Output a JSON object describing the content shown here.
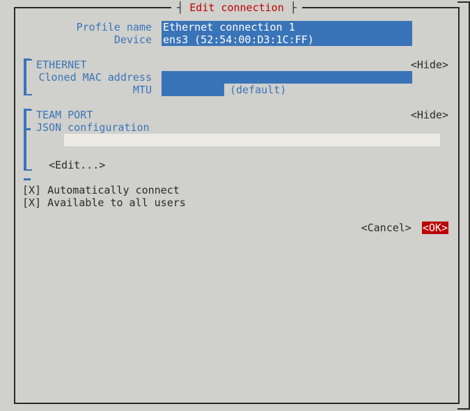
{
  "title": "Edit connection",
  "fields": {
    "profile_name": {
      "label": "Profile name",
      "value": "Ethernet connection 1"
    },
    "device": {
      "label": "Device",
      "value": "ens3 (52:54:00:D3:1C:FF)"
    }
  },
  "sections": {
    "ethernet": {
      "name": "ETHERNET",
      "toggle": "<Hide>",
      "cloned_mac": {
        "label": "Cloned MAC address",
        "value": ""
      },
      "mtu": {
        "label": "MTU",
        "value": "",
        "hint": "(default)"
      }
    },
    "team_port": {
      "name": "TEAM PORT",
      "toggle": "<Hide>",
      "json_conf": {
        "label": "JSON configuration",
        "value": ""
      },
      "edit": "<Edit...>"
    }
  },
  "checks": {
    "auto": {
      "label": "Automatically connect",
      "checked": true
    },
    "users": {
      "label": "Available to all users",
      "checked": true
    }
  },
  "buttons": {
    "cancel": "<Cancel>",
    "ok": "<OK>"
  }
}
